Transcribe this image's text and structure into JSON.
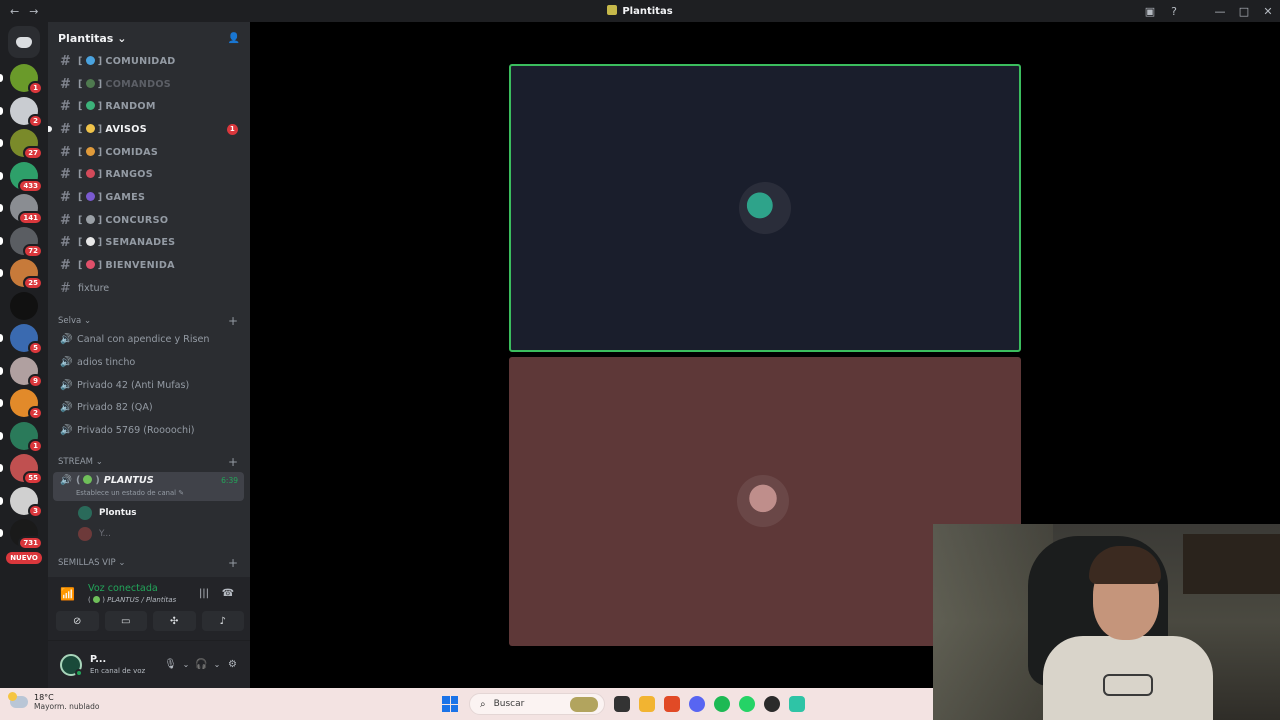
{
  "titlebar": {
    "back": "←",
    "forward": "→",
    "title": "Plantitas",
    "inbox_icon": "▣",
    "help_icon": "?",
    "minimize": "—",
    "maximize": "□",
    "close": "✕"
  },
  "rail": {
    "servers": [
      {
        "color": "#6a9a2a",
        "badge": "1"
      },
      {
        "color": "#c9ccd1",
        "badge": "2"
      },
      {
        "color": "#7a8a2a",
        "badge": "27"
      },
      {
        "color": "#2ea06a",
        "badge": "433"
      },
      {
        "color": "#8a8d92",
        "badge": "141"
      },
      {
        "color": "#5a5d62",
        "badge": "72"
      },
      {
        "color": "#c77a3a",
        "badge": "25"
      },
      {
        "color": "#111111",
        "badge": ""
      },
      {
        "color": "#3a6ab0",
        "badge": "5"
      },
      {
        "color": "#b0a0a0",
        "badge": "9"
      },
      {
        "color": "#e28a2a",
        "badge": "2"
      },
      {
        "color": "#2a7a5a",
        "badge": "1"
      },
      {
        "color": "#c05050",
        "badge": "55"
      },
      {
        "color": "#d0d0d0",
        "badge": "3"
      },
      {
        "color": "#1a1a1a",
        "badge": "731"
      }
    ],
    "nuevo_label": "NUEVO"
  },
  "guild": {
    "name": "Plantitas",
    "chevron": "⌄",
    "add_member_icon": "👤"
  },
  "text_channels": [
    {
      "name": "COMUNIDAD",
      "emoji_color": "#4aa3df",
      "state": "normal"
    },
    {
      "name": "COMANDOS",
      "emoji_color": "#4f7a4f",
      "state": "muted"
    },
    {
      "name": "RANDOM",
      "emoji_color": "#3cb27a",
      "state": "normal"
    },
    {
      "name": "AVISOS",
      "emoji_color": "#f0c34a",
      "state": "unread",
      "mentions": "1"
    },
    {
      "name": "COMIDAS",
      "emoji_color": "#e09a3a",
      "state": "normal"
    },
    {
      "name": "RANGOS",
      "emoji_color": "#d34a5a",
      "state": "normal"
    },
    {
      "name": "GAMES",
      "emoji_color": "#7a5ad0",
      "state": "normal"
    },
    {
      "name": "CONCURSO",
      "emoji_color": "#9aa0a6",
      "state": "normal"
    },
    {
      "name": "SEMANADES",
      "emoji_color": "#e8e8e8",
      "state": "normal"
    },
    {
      "name": "BIENVENIDA",
      "emoji_color": "#e0506a",
      "state": "normal"
    }
  ],
  "plain_channel": "fixture",
  "categories": {
    "selva": "Selva",
    "stream": "STREAM",
    "vip": "SEMILLAS VIP",
    "chevron": "⌄",
    "plus": "+"
  },
  "selva_channels": [
    "Canal con apendice y Risen",
    "adios tincho",
    "Privado 42 (Anti Mufas)",
    "Privado 82 (QA)",
    "Privado 5769 (Roooochi)"
  ],
  "active_voice": {
    "name": "PLANTUS",
    "timer": "6:39",
    "status_hint": "Establece un estado de canal",
    "members": [
      {
        "name": "Plontus",
        "color": "#2a6a5a"
      },
      {
        "name": "Y...",
        "color": "#6d3a3a"
      }
    ]
  },
  "voice_panel": {
    "status": "Voz conectada",
    "channel": "PLANTUS / Plantitas",
    "signal_icon": "📶",
    "noise_icon": "|||",
    "disconnect_icon": "☎",
    "buttons": [
      {
        "name": "camera-off-icon",
        "glyph": "⊘"
      },
      {
        "name": "screen-share-icon",
        "glyph": "▭"
      },
      {
        "name": "activities-icon",
        "glyph": "✣"
      },
      {
        "name": "soundboard-icon",
        "glyph": "♪"
      }
    ]
  },
  "user_panel": {
    "name": "P...",
    "status": "En canal de voz",
    "mic_icon": "🎙",
    "headset_icon": "🎧",
    "settings_icon": "⚙",
    "chevron": "⌄"
  },
  "taskbar": {
    "temp": "18°C",
    "weather": "Mayorm. nublado",
    "search_placeholder": "Buscar",
    "search_icon": "⌕",
    "apps": [
      {
        "name": "task-view-icon",
        "color": "#333333"
      },
      {
        "name": "file-explorer-icon",
        "color": "#f2b431"
      },
      {
        "name": "brave-icon",
        "color": "#e14a26"
      },
      {
        "name": "discord-icon",
        "color": "#5865f2"
      },
      {
        "name": "spotify-icon",
        "color": "#1db954"
      },
      {
        "name": "whatsapp-icon",
        "color": "#25d366"
      },
      {
        "name": "obs-icon",
        "color": "#2b2b2b"
      },
      {
        "name": "audio-app-icon",
        "color": "#2ec4a6"
      }
    ]
  },
  "colors": {
    "accent_green": "#23a55a",
    "mention_red": "#da373c",
    "speaking_border": "#3bbd5e"
  }
}
